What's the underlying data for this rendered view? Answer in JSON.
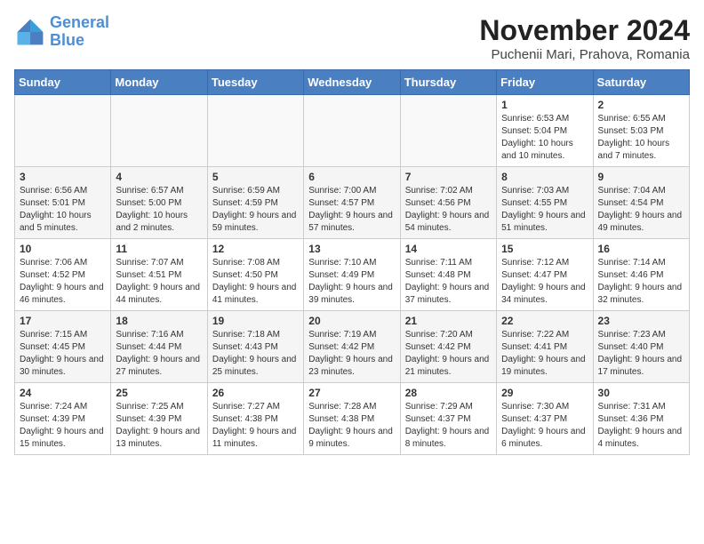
{
  "header": {
    "logo_line1": "General",
    "logo_line2": "Blue",
    "month_year": "November 2024",
    "location": "Puchenii Mari, Prahova, Romania"
  },
  "days_of_week": [
    "Sunday",
    "Monday",
    "Tuesday",
    "Wednesday",
    "Thursday",
    "Friday",
    "Saturday"
  ],
  "weeks": [
    [
      {
        "day": "",
        "info": ""
      },
      {
        "day": "",
        "info": ""
      },
      {
        "day": "",
        "info": ""
      },
      {
        "day": "",
        "info": ""
      },
      {
        "day": "",
        "info": ""
      },
      {
        "day": "1",
        "info": "Sunrise: 6:53 AM\nSunset: 5:04 PM\nDaylight: 10 hours and 10 minutes."
      },
      {
        "day": "2",
        "info": "Sunrise: 6:55 AM\nSunset: 5:03 PM\nDaylight: 10 hours and 7 minutes."
      }
    ],
    [
      {
        "day": "3",
        "info": "Sunrise: 6:56 AM\nSunset: 5:01 PM\nDaylight: 10 hours and 5 minutes."
      },
      {
        "day": "4",
        "info": "Sunrise: 6:57 AM\nSunset: 5:00 PM\nDaylight: 10 hours and 2 minutes."
      },
      {
        "day": "5",
        "info": "Sunrise: 6:59 AM\nSunset: 4:59 PM\nDaylight: 9 hours and 59 minutes."
      },
      {
        "day": "6",
        "info": "Sunrise: 7:00 AM\nSunset: 4:57 PM\nDaylight: 9 hours and 57 minutes."
      },
      {
        "day": "7",
        "info": "Sunrise: 7:02 AM\nSunset: 4:56 PM\nDaylight: 9 hours and 54 minutes."
      },
      {
        "day": "8",
        "info": "Sunrise: 7:03 AM\nSunset: 4:55 PM\nDaylight: 9 hours and 51 minutes."
      },
      {
        "day": "9",
        "info": "Sunrise: 7:04 AM\nSunset: 4:54 PM\nDaylight: 9 hours and 49 minutes."
      }
    ],
    [
      {
        "day": "10",
        "info": "Sunrise: 7:06 AM\nSunset: 4:52 PM\nDaylight: 9 hours and 46 minutes."
      },
      {
        "day": "11",
        "info": "Sunrise: 7:07 AM\nSunset: 4:51 PM\nDaylight: 9 hours and 44 minutes."
      },
      {
        "day": "12",
        "info": "Sunrise: 7:08 AM\nSunset: 4:50 PM\nDaylight: 9 hours and 41 minutes."
      },
      {
        "day": "13",
        "info": "Sunrise: 7:10 AM\nSunset: 4:49 PM\nDaylight: 9 hours and 39 minutes."
      },
      {
        "day": "14",
        "info": "Sunrise: 7:11 AM\nSunset: 4:48 PM\nDaylight: 9 hours and 37 minutes."
      },
      {
        "day": "15",
        "info": "Sunrise: 7:12 AM\nSunset: 4:47 PM\nDaylight: 9 hours and 34 minutes."
      },
      {
        "day": "16",
        "info": "Sunrise: 7:14 AM\nSunset: 4:46 PM\nDaylight: 9 hours and 32 minutes."
      }
    ],
    [
      {
        "day": "17",
        "info": "Sunrise: 7:15 AM\nSunset: 4:45 PM\nDaylight: 9 hours and 30 minutes."
      },
      {
        "day": "18",
        "info": "Sunrise: 7:16 AM\nSunset: 4:44 PM\nDaylight: 9 hours and 27 minutes."
      },
      {
        "day": "19",
        "info": "Sunrise: 7:18 AM\nSunset: 4:43 PM\nDaylight: 9 hours and 25 minutes."
      },
      {
        "day": "20",
        "info": "Sunrise: 7:19 AM\nSunset: 4:42 PM\nDaylight: 9 hours and 23 minutes."
      },
      {
        "day": "21",
        "info": "Sunrise: 7:20 AM\nSunset: 4:42 PM\nDaylight: 9 hours and 21 minutes."
      },
      {
        "day": "22",
        "info": "Sunrise: 7:22 AM\nSunset: 4:41 PM\nDaylight: 9 hours and 19 minutes."
      },
      {
        "day": "23",
        "info": "Sunrise: 7:23 AM\nSunset: 4:40 PM\nDaylight: 9 hours and 17 minutes."
      }
    ],
    [
      {
        "day": "24",
        "info": "Sunrise: 7:24 AM\nSunset: 4:39 PM\nDaylight: 9 hours and 15 minutes."
      },
      {
        "day": "25",
        "info": "Sunrise: 7:25 AM\nSunset: 4:39 PM\nDaylight: 9 hours and 13 minutes."
      },
      {
        "day": "26",
        "info": "Sunrise: 7:27 AM\nSunset: 4:38 PM\nDaylight: 9 hours and 11 minutes."
      },
      {
        "day": "27",
        "info": "Sunrise: 7:28 AM\nSunset: 4:38 PM\nDaylight: 9 hours and 9 minutes."
      },
      {
        "day": "28",
        "info": "Sunrise: 7:29 AM\nSunset: 4:37 PM\nDaylight: 9 hours and 8 minutes."
      },
      {
        "day": "29",
        "info": "Sunrise: 7:30 AM\nSunset: 4:37 PM\nDaylight: 9 hours and 6 minutes."
      },
      {
        "day": "30",
        "info": "Sunrise: 7:31 AM\nSunset: 4:36 PM\nDaylight: 9 hours and 4 minutes."
      }
    ]
  ]
}
